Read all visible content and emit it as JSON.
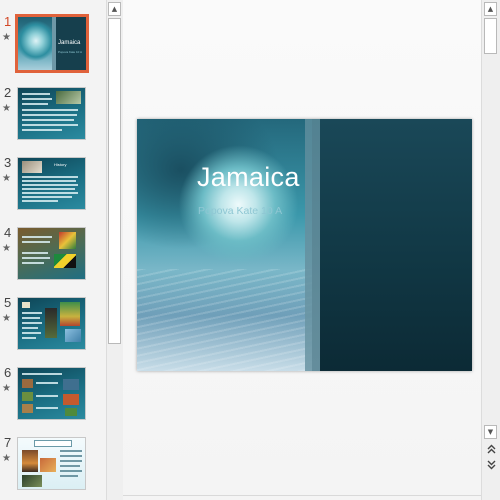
{
  "thumbnails": [
    {
      "number": "1",
      "selected": true,
      "title": "Jamaica",
      "subtitle": "Popova Kate 10 A"
    },
    {
      "number": "2",
      "selected": false
    },
    {
      "number": "3",
      "selected": false,
      "heading": "History"
    },
    {
      "number": "4",
      "selected": false
    },
    {
      "number": "5",
      "selected": false
    },
    {
      "number": "6",
      "selected": false
    },
    {
      "number": "7",
      "selected": false
    }
  ],
  "star_glyph": "★",
  "slide": {
    "title": "Jamaica",
    "subtitle": "Popova Kate 10 A"
  },
  "icons": {
    "scroll_up": "scroll-up-arrow-icon",
    "scroll_down": "scroll-down-arrow-icon",
    "prev_slide": "previous-slide-icon",
    "next_slide": "next-slide-icon"
  },
  "colors": {
    "selection_border": "#e0623b",
    "selected_number": "#d24726",
    "slide_dark": "#113845",
    "subtitle": "#8fc7d3"
  }
}
